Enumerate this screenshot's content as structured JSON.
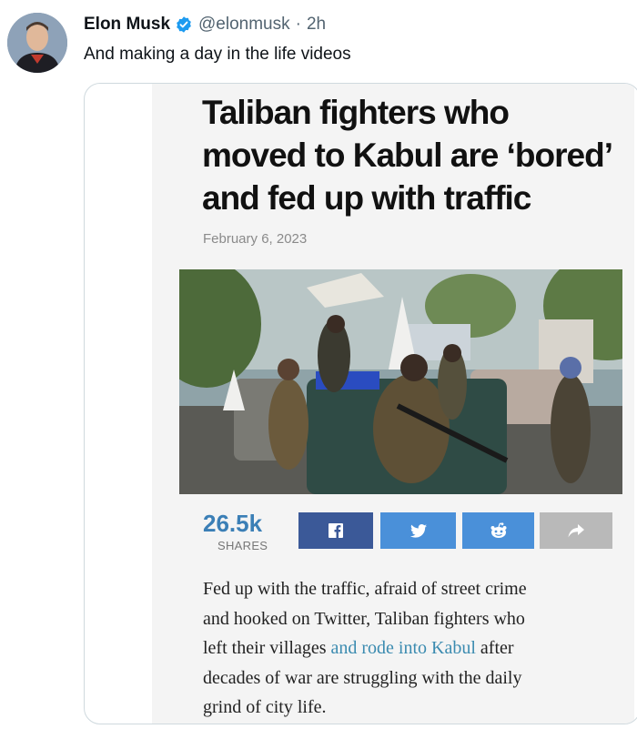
{
  "tweet": {
    "display_name": "Elon Musk",
    "handle": "@elonmusk",
    "separator": "·",
    "time": "2h",
    "text": "And making a day in the life videos",
    "verified_icon": "verified-badge-icon",
    "colors": {
      "verified": "#1d9bf0",
      "handle": "#536471"
    }
  },
  "article": {
    "headline_lines": [
      "Taliban fighters who",
      "moved to Kabul are ‘bored’",
      "and fed up with traffic"
    ],
    "date": "February 6, 2023",
    "photo_icon": "news-photo",
    "share": {
      "count": "26.5k",
      "label": "SHARES",
      "buttons": [
        {
          "icon": "facebook-icon",
          "color": "#3b5998"
        },
        {
          "icon": "twitter-icon",
          "color": "#4a90d9"
        },
        {
          "icon": "reddit-icon",
          "color": "#4a90d9"
        },
        {
          "icon": "share-arrow-icon",
          "color": "#b9b9b9"
        }
      ]
    },
    "body": {
      "line1": "Fed up with the traffic, afraid of street crime",
      "line2": "and hooked on Twitter, Taliban fighters who",
      "line3_pre": "left their villages ",
      "line3_link": "and rode into Kabul",
      "line3_post": " after",
      "line4": "decades of war are struggling with the daily",
      "line5": "grind of city life."
    }
  }
}
